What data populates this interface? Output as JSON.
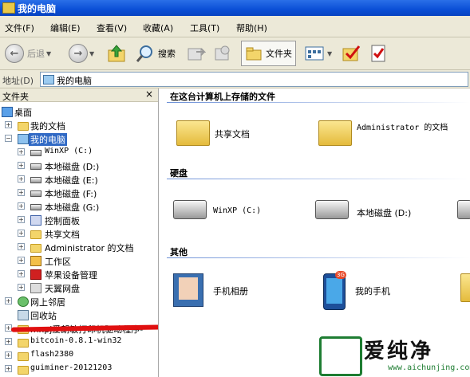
{
  "window": {
    "title": "我的电脑"
  },
  "menu": [
    "文件(F)",
    "编辑(E)",
    "查看(V)",
    "收藏(A)",
    "工具(T)",
    "帮助(H)"
  ],
  "toolbar": {
    "back": "后退",
    "search": "搜索",
    "folders": "文件夹"
  },
  "address": {
    "label": "地址(D)",
    "value": "我的电脑"
  },
  "folders_pane": {
    "title": "文件夹",
    "close": "×"
  },
  "tree": [
    {
      "label": "桌面"
    },
    {
      "label": "我的文档"
    },
    {
      "label": "我的电脑"
    },
    {
      "label": "WinXP (C:)"
    },
    {
      "label": "本地磁盘 (D:)"
    },
    {
      "label": "本地磁盘 (E:)"
    },
    {
      "label": "本地磁盘 (F:)"
    },
    {
      "label": "本地磁盘 (G:)"
    },
    {
      "label": "控制面板"
    },
    {
      "label": "共享文档"
    },
    {
      "label": "Administrator 的文档"
    },
    {
      "label": "工作区"
    },
    {
      "label": "苹果设备管理"
    },
    {
      "label": "天翼网盘"
    },
    {
      "label": "网上邻居"
    },
    {
      "label": "回收站"
    },
    {
      "label": "mxpj爱朗敏打印机驱动程序-"
    },
    {
      "label": "bitcoin-0.8.1-win32"
    },
    {
      "label": "flash2380"
    },
    {
      "label": "guiminer-20121203"
    }
  ],
  "main": {
    "section1": "在这台计算机上存储的文件",
    "files": [
      "共享文档",
      "Administrator 的文档"
    ],
    "section2": "硬盘",
    "drives": [
      "WinXP (C:)",
      "本地磁盘 (D:)"
    ],
    "section3": "其他",
    "others": [
      "手机相册",
      "我的手机"
    ],
    "phone_badge": "3G"
  },
  "watermark": {
    "text": "爱纯净",
    "url": "www.aichunjing.com"
  },
  "colors": {
    "title_bar": "#0a4fd6",
    "selection": "#316ac5",
    "chrome": "#ece9d8"
  }
}
